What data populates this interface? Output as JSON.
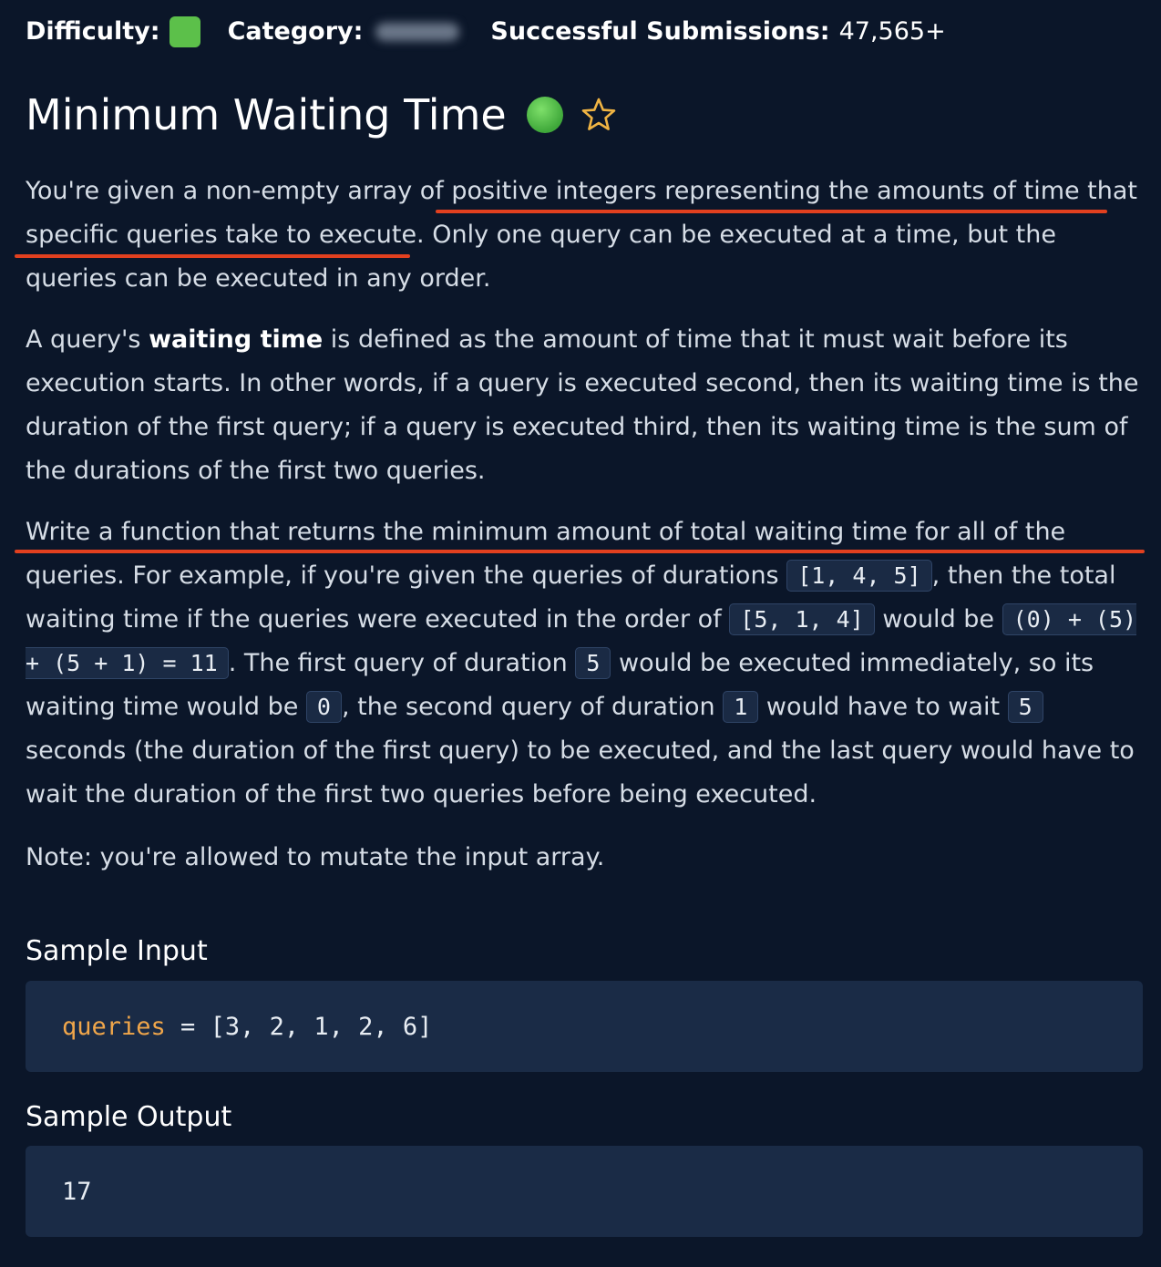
{
  "meta": {
    "difficulty_label": "Difficulty:",
    "category_label": "Category:",
    "submissions_label": "Successful Submissions:",
    "submissions_value": "47,565+",
    "difficulty_color": "#5cc04a"
  },
  "title": "Minimum Waiting Time",
  "icons": {
    "status": "green-dot-icon",
    "favorite": "star-icon"
  },
  "description": {
    "p1": {
      "a": "You're given a non-empty array of ",
      "b": "positive integers representing the amounts of time that specific queries take to execute.",
      "c": " Only one query can be executed at a time, but the queries can be executed in any order."
    },
    "p2": {
      "a": "A query's ",
      "bold": "waiting time",
      "b": " is defined as the amount of time that it must wait before its execution starts. In other words, if a query is executed second, then its waiting time is the duration of the first query; if a query is executed third, then its waiting time is the sum of the durations of the first two queries."
    },
    "p3": {
      "a": "Write a function that returns the minimum amount of total waiting time for all of the queries.",
      "b": " For example, if you're given the queries of durations ",
      "code1": "[1, 4, 5]",
      "c": ", then the total waiting time if the queries were executed in the order of ",
      "code2": "[5, 1, 4]",
      "d": " would be ",
      "code3": "(0) + (5) + (5 + 1) = 11",
      "e": ". The first query of duration ",
      "code4": "5",
      "f": " would be executed immediately, so its waiting time would be ",
      "code5": "0",
      "g": ", the second query of duration ",
      "code6": "1",
      "h": " would have to wait ",
      "code7": "5",
      "i": " seconds (the duration of the first query) to be executed, and the last query would have to wait the duration of the first two queries before being executed."
    },
    "note": "Note: you're allowed to mutate the input array."
  },
  "sample_input": {
    "heading": "Sample Input",
    "var": "queries",
    "rest": " = [3, 2, 1, 2, 6]"
  },
  "sample_output": {
    "heading": "Sample Output",
    "value": "17"
  },
  "colors": {
    "background": "#0b1629",
    "code_box": "#1a2b46",
    "underline": "#e2401f",
    "variable": "#f0a64a"
  }
}
